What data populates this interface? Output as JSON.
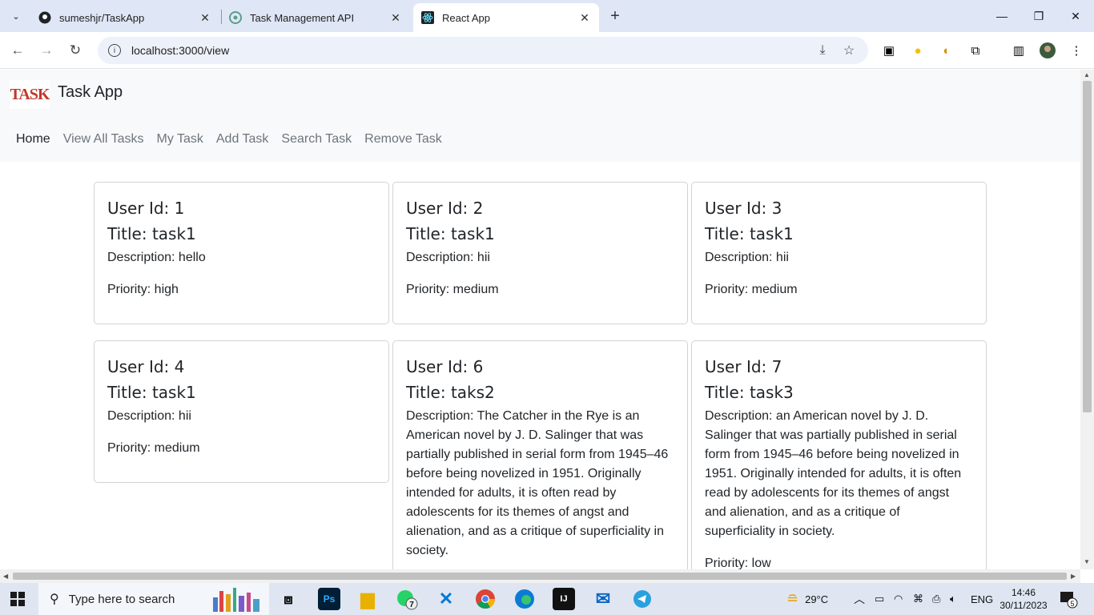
{
  "browser": {
    "tabs": [
      {
        "title": "sumeshjr/TaskApp",
        "favicon": "github-icon"
      },
      {
        "title": "Task Management API",
        "favicon": "openai-icon"
      },
      {
        "title": "React App",
        "favicon": "react-icon"
      }
    ],
    "url": "localhost:3000/view"
  },
  "app": {
    "brand_logo_text": "TASK",
    "brand_name": "Task App",
    "nav": [
      "Home",
      "View All Tasks",
      "My Task",
      "Add Task",
      "Search Task",
      "Remove Task"
    ]
  },
  "tasks": [
    {
      "user": "User Id: 1",
      "title": "Title: task1",
      "description": "Description: hello",
      "priority": "Priority: high"
    },
    {
      "user": "User Id: 2",
      "title": "Title: task1",
      "description": "Description: hii",
      "priority": "Priority: medium"
    },
    {
      "user": "User Id: 3",
      "title": "Title: task1",
      "description": "Description: hii",
      "priority": "Priority: medium"
    },
    {
      "user": "User Id: 4",
      "title": "Title: task1",
      "description": "Description: hii",
      "priority": "Priority: medium"
    },
    {
      "user": "User Id: 6",
      "title": "Title: taks2",
      "description": "Description: The Catcher in the Rye is an American novel by J. D. Salinger that was partially published in serial form from 1945–46 before being novelized in 1951. Originally intended for adults, it is often read by adolescents for its themes of angst and alienation, and as a critique of superficiality in society.",
      "priority": ""
    },
    {
      "user": "User Id: 7",
      "title": "Title: task3",
      "description": "Description: an American novel by J. D. Salinger that was partially published in serial form from 1945–46 before being novelized in 1951. Originally intended for adults, it is often read by adolescents for its themes of angst and alienation, and as a critique of superficiality in society.",
      "priority": "Priority: low"
    }
  ],
  "taskbar": {
    "search_placeholder": "Type here to search",
    "whatsapp_badge": "7",
    "weather": "29°C",
    "language": "ENG",
    "time": "14:46",
    "date": "30/11/2023",
    "notifications": "5"
  }
}
